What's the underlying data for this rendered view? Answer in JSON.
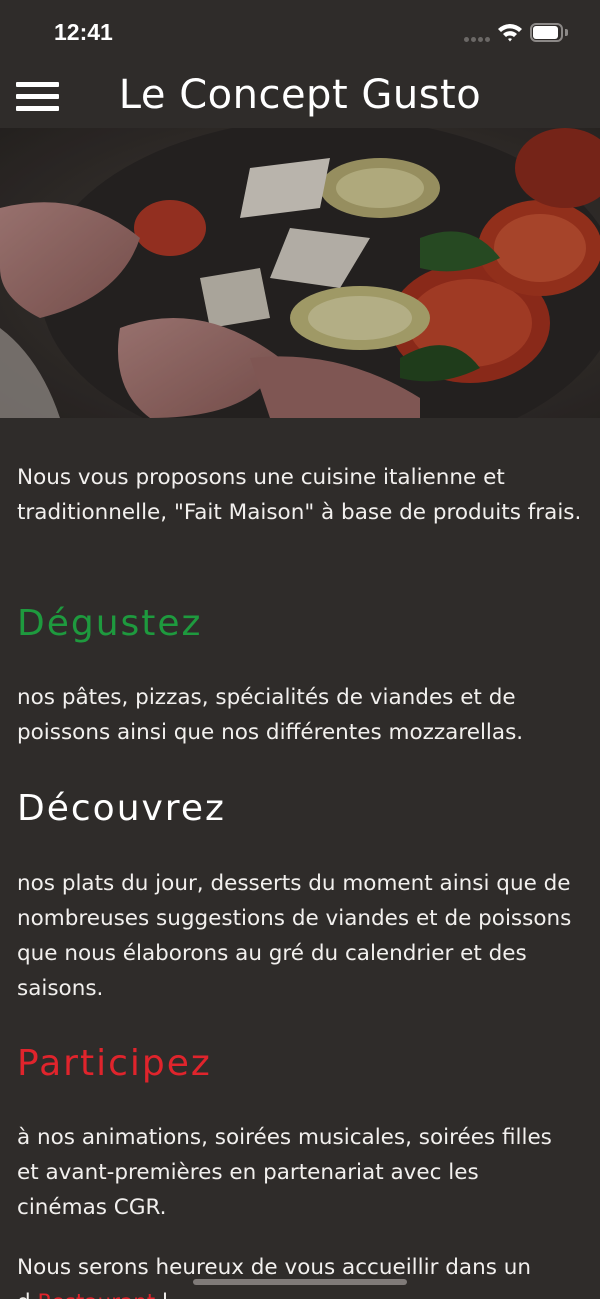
{
  "status_bar": {
    "time": "12:41"
  },
  "nav": {
    "title": "Le Concept Gusto",
    "menu_icon": "hamburger-menu-icon"
  },
  "hero": {
    "alt": "plate-photo"
  },
  "content": {
    "intro": "Nous vous proposons une cuisine italienne et traditionnelle, \"Fait Maison\" à base de produits frais.",
    "sections": [
      {
        "heading": "Dégustez",
        "color": "#1e9a3e",
        "text": "nos pâtes, pizzas, spécialités de viandes et de poissons ainsi que nos différentes mozzarellas."
      },
      {
        "heading": "Découvrez",
        "color": "#ffffff",
        "text": "nos plats du jour, desserts du moment ainsi que de nombreuses suggestions de viandes et de poissons que nous élaborons au gré du calendrier et des saisons."
      },
      {
        "heading": "Participez",
        "color": "#e0242c",
        "text": "à nos animations, soirées musicales, soirées filles et avant-premières en partenariat avec les cinémas CGR."
      }
    ],
    "closing_start": "Nous serons heureux de vous accueillir dans un",
    "closing_partial": "d",
    "closing_link": "Restaurant",
    "closing_rest": " l"
  },
  "colors": {
    "background": "#2f2c2a",
    "green": "#1e9a3e",
    "red": "#e0242c"
  }
}
